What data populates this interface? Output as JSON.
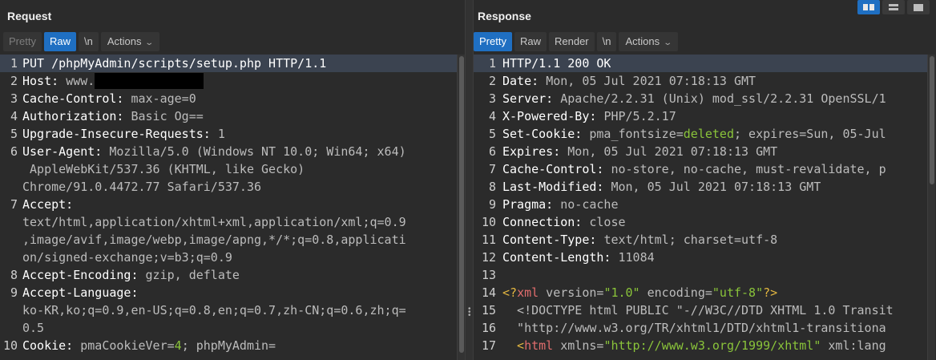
{
  "request": {
    "title": "Request",
    "toolbar": {
      "pretty": "Pretty",
      "raw": "Raw",
      "newline": "\\n",
      "actions": "Actions"
    },
    "lines": [
      {
        "n": "1",
        "key": "PUT /phpMyAdmin/scripts/setup.php HTTP/1.1",
        "val": ""
      },
      {
        "n": "2",
        "key": "Host: ",
        "val": "www."
      },
      {
        "n": "3",
        "key": "Cache-Control: ",
        "val": "max-age=0"
      },
      {
        "n": "4",
        "key": "Authorization: ",
        "val": "Basic Og=="
      },
      {
        "n": "5",
        "key": "Upgrade-Insecure-Requests: ",
        "val": "1"
      },
      {
        "n": "6",
        "key": "User-Agent: ",
        "val": "Mozilla/5.0 (Windows NT 10.0; Win64; x64)"
      },
      {
        "n": "",
        "key": "",
        "val": " AppleWebKit/537.36 (KHTML, like Gecko)"
      },
      {
        "n": "",
        "key": "",
        "val": "Chrome/91.0.4472.77 Safari/537.36"
      },
      {
        "n": "7",
        "key": "Accept: ",
        "val": ""
      },
      {
        "n": "",
        "key": "",
        "val": "text/html,application/xhtml+xml,application/xml;q=0.9"
      },
      {
        "n": "",
        "key": "",
        "val": ",image/avif,image/webp,image/apng,*/*;q=0.8,applicati"
      },
      {
        "n": "",
        "key": "",
        "val": "on/signed-exchange;v=b3;q=0.9"
      },
      {
        "n": "8",
        "key": "Accept-Encoding: ",
        "val": "gzip, deflate"
      },
      {
        "n": "9",
        "key": "Accept-Language: ",
        "val": ""
      },
      {
        "n": "",
        "key": "",
        "val": "ko-KR,ko;q=0.9,en-US;q=0.8,en;q=0.7,zh-CN;q=0.6,zh;q="
      },
      {
        "n": "",
        "key": "",
        "val": "0.5"
      },
      {
        "n": "10",
        "key": "Cookie: ",
        "val": "pmaCookieVer=",
        "green": "4",
        "val2": "; phpMyAdmin="
      }
    ]
  },
  "response": {
    "title": "Response",
    "toolbar": {
      "pretty": "Pretty",
      "raw": "Raw",
      "render": "Render",
      "newline": "\\n",
      "actions": "Actions"
    },
    "lines": [
      {
        "n": "1",
        "key": "HTTP/1.1 200 OK",
        "val": ""
      },
      {
        "n": "2",
        "key": "Date: ",
        "val": "Mon, 05 Jul 2021 07:18:13 GMT"
      },
      {
        "n": "3",
        "key": "Server: ",
        "val": "Apache/2.2.31 (Unix) mod_ssl/2.2.31 OpenSSL/1"
      },
      {
        "n": "4",
        "key": "X-Powered-By: ",
        "val": "PHP/5.2.17"
      },
      {
        "n": "5",
        "key": "Set-Cookie: ",
        "val": "pma_fontsize=",
        "green": "deleted",
        "val2": "; expires=Sun, 05-Jul"
      },
      {
        "n": "6",
        "key": "Expires: ",
        "val": "Mon, 05 Jul 2021 07:18:13 GMT"
      },
      {
        "n": "7",
        "key": "Cache-Control: ",
        "val": "no-store, no-cache, must-revalidate, p"
      },
      {
        "n": "8",
        "key": "Last-Modified: ",
        "val": "Mon, 05 Jul 2021 07:18:13 GMT"
      },
      {
        "n": "9",
        "key": "Pragma: ",
        "val": "no-cache"
      },
      {
        "n": "10",
        "key": "Connection: ",
        "val": "close"
      },
      {
        "n": "11",
        "key": "Content-Type: ",
        "val": "text/html; charset=utf-8"
      },
      {
        "n": "12",
        "key": "Content-Length: ",
        "val": "11084"
      },
      {
        "n": "13",
        "key": "",
        "val": ""
      },
      {
        "n": "14",
        "key": "",
        "xml": true,
        "a": "<?",
        "b": "xml",
        "c": " version=",
        "d": "\"1.0\"",
        "e": " encoding=",
        "f": "\"utf-8\"",
        "g": "?>"
      },
      {
        "n": "15",
        "key": "",
        "val": "  <!DOCTYPE html PUBLIC \"-//W3C//DTD XHTML 1.0 Transit"
      },
      {
        "n": "16",
        "key": "",
        "val": "  \"http://www.w3.org/TR/xhtml1/DTD/xhtml1-transitiona"
      },
      {
        "n": "17",
        "key": "",
        "xml2": true,
        "a": "  <",
        "b": "html",
        "c": " xmlns=",
        "d": "\"http://www.w3.org/1999/xhtml\"",
        "e": " xml:lang"
      }
    ]
  }
}
